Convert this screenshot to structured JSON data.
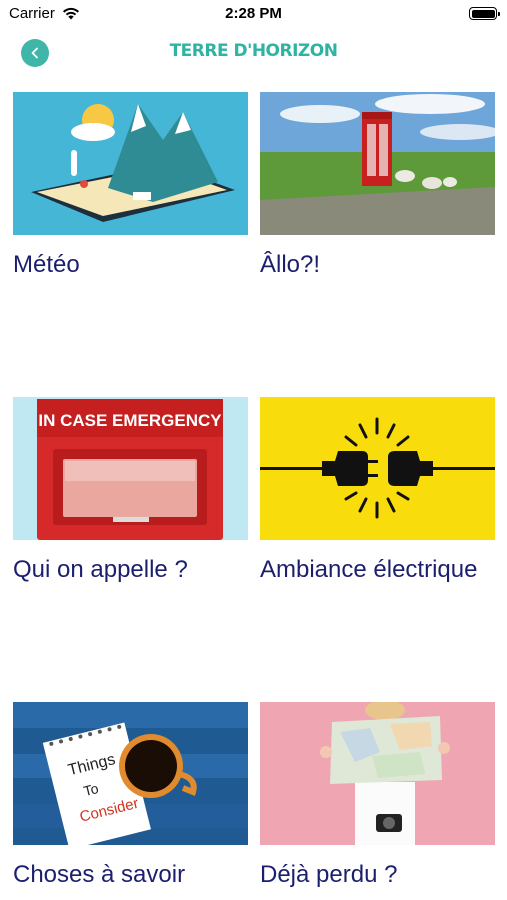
{
  "status_bar": {
    "carrier": "Carrier",
    "time": "2:28 PM"
  },
  "header": {
    "brand": "TERRE D'HORIZON",
    "back_icon": "chevron-left-icon",
    "accent_color": "#3fb6a8"
  },
  "tiles": [
    {
      "label": "Météo",
      "image": "weather-tablet-illustration"
    },
    {
      "label": "Âllo?!",
      "image": "red-phone-box-photo"
    },
    {
      "label": "Qui on appelle ?",
      "image": "emergency-box-photo",
      "image_text": "IN CASE EMERGENCY"
    },
    {
      "label": "Ambiance électrique",
      "image": "plug-socket-illustration"
    },
    {
      "label": "Choses à savoir",
      "image": "coffee-note-photo",
      "image_text_lines": [
        "Things",
        "To",
        "Consider"
      ]
    },
    {
      "label": "Déjà perdu ?",
      "image": "person-with-map-photo"
    }
  ],
  "colors": {
    "label_text": "#1c1f6e",
    "brand_teal": "#2fb3a3"
  }
}
